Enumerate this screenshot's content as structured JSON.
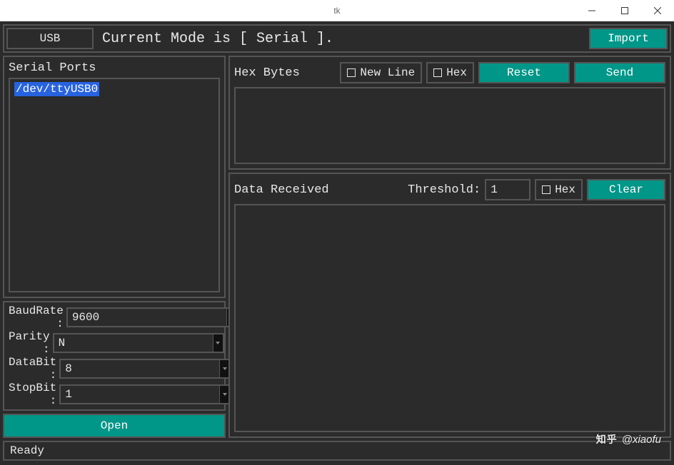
{
  "window": {
    "title": "tk"
  },
  "topbar": {
    "usb_label": "USB",
    "mode_text": "Current Mode is [ Serial ].",
    "import_label": "Import"
  },
  "serial_ports": {
    "title": "Serial Ports",
    "items": [
      "/dev/ttyUSB0"
    ]
  },
  "settings": {
    "baud_label": "BaudRate :",
    "baud_value": "9600",
    "parity_label": "Parity :",
    "parity_value": "N",
    "databit_label": "DataBit :",
    "databit_value": "8",
    "stopbit_label": "StopBit :",
    "stopbit_value": "1",
    "open_label": "Open"
  },
  "hex_panel": {
    "title": "Hex Bytes",
    "newline_label": "New Line",
    "hex_label": "Hex",
    "reset_label": "Reset",
    "send_label": "Send"
  },
  "data_panel": {
    "title": "Data Received",
    "threshold_label": "Threshold:",
    "threshold_value": "1",
    "hex_label": "Hex",
    "clear_label": "Clear"
  },
  "status": {
    "text": "Ready"
  },
  "watermark": {
    "brand": "知乎",
    "handle": "@xiaofu"
  }
}
